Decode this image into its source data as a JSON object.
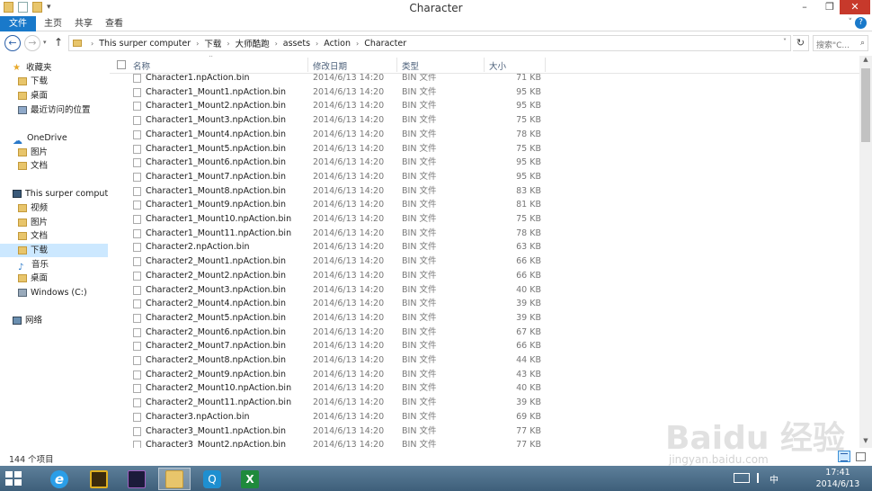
{
  "window": {
    "title": "Character",
    "minimize_glyph": "–",
    "maximize_glyph": "❐",
    "close_glyph": "✕"
  },
  "ribbon": {
    "tabs": [
      {
        "label": "文件",
        "active": true
      },
      {
        "label": "主页"
      },
      {
        "label": "共享"
      },
      {
        "label": "查看"
      }
    ],
    "expand_glyph": "˅",
    "help_glyph": "?"
  },
  "address": {
    "crumbs": [
      "This surper computer",
      "下载",
      "大师酷跑",
      "assets",
      "Action",
      "Character"
    ],
    "refresh_glyph": "↻",
    "search_placeholder": "搜索\"C...",
    "search_icon": "search-icon"
  },
  "nav": {
    "items": [
      {
        "label": "收藏夹",
        "icon": "star-icon",
        "level": 0
      },
      {
        "label": "下载",
        "icon": "folder-icon",
        "level": 1
      },
      {
        "label": "桌面",
        "icon": "folder-icon",
        "level": 1
      },
      {
        "label": "最近访问的位置",
        "icon": "recent-icon",
        "level": 1
      },
      {
        "label": "OneDrive",
        "icon": "cloud-icon",
        "level": 0
      },
      {
        "label": "图片",
        "icon": "folder-icon",
        "level": 1
      },
      {
        "label": "文档",
        "icon": "folder-icon",
        "level": 1
      },
      {
        "label": "This surper computer",
        "icon": "computer-icon",
        "level": 0
      },
      {
        "label": "视频",
        "icon": "folder-icon",
        "level": 1
      },
      {
        "label": "图片",
        "icon": "folder-icon",
        "level": 1
      },
      {
        "label": "文档",
        "icon": "folder-icon",
        "level": 1
      },
      {
        "label": "下载",
        "icon": "folder-icon",
        "level": 1,
        "selected": true
      },
      {
        "label": "音乐",
        "icon": "music-icon",
        "level": 1
      },
      {
        "label": "桌面",
        "icon": "folder-icon",
        "level": 1
      },
      {
        "label": "Windows (C:)",
        "icon": "drive-icon",
        "level": 1
      },
      {
        "label": "网络",
        "icon": "network-icon",
        "level": 0
      }
    ]
  },
  "filelist": {
    "columns": {
      "name": "名称",
      "date": "修改日期",
      "type": "类型",
      "size": "大小"
    },
    "rows": [
      {
        "name": "Character1.npAction.bin",
        "date": "2014/6/13 14:20",
        "type": "BIN 文件",
        "size": "71 KB"
      },
      {
        "name": "Character1_Mount1.npAction.bin",
        "date": "2014/6/13 14:20",
        "type": "BIN 文件",
        "size": "95 KB"
      },
      {
        "name": "Character1_Mount2.npAction.bin",
        "date": "2014/6/13 14:20",
        "type": "BIN 文件",
        "size": "95 KB"
      },
      {
        "name": "Character1_Mount3.npAction.bin",
        "date": "2014/6/13 14:20",
        "type": "BIN 文件",
        "size": "75 KB"
      },
      {
        "name": "Character1_Mount4.npAction.bin",
        "date": "2014/6/13 14:20",
        "type": "BIN 文件",
        "size": "78 KB"
      },
      {
        "name": "Character1_Mount5.npAction.bin",
        "date": "2014/6/13 14:20",
        "type": "BIN 文件",
        "size": "75 KB"
      },
      {
        "name": "Character1_Mount6.npAction.bin",
        "date": "2014/6/13 14:20",
        "type": "BIN 文件",
        "size": "95 KB"
      },
      {
        "name": "Character1_Mount7.npAction.bin",
        "date": "2014/6/13 14:20",
        "type": "BIN 文件",
        "size": "95 KB"
      },
      {
        "name": "Character1_Mount8.npAction.bin",
        "date": "2014/6/13 14:20",
        "type": "BIN 文件",
        "size": "83 KB"
      },
      {
        "name": "Character1_Mount9.npAction.bin",
        "date": "2014/6/13 14:20",
        "type": "BIN 文件",
        "size": "81 KB"
      },
      {
        "name": "Character1_Mount10.npAction.bin",
        "date": "2014/6/13 14:20",
        "type": "BIN 文件",
        "size": "75 KB"
      },
      {
        "name": "Character1_Mount11.npAction.bin",
        "date": "2014/6/13 14:20",
        "type": "BIN 文件",
        "size": "78 KB"
      },
      {
        "name": "Character2.npAction.bin",
        "date": "2014/6/13 14:20",
        "type": "BIN 文件",
        "size": "63 KB"
      },
      {
        "name": "Character2_Mount1.npAction.bin",
        "date": "2014/6/13 14:20",
        "type": "BIN 文件",
        "size": "66 KB"
      },
      {
        "name": "Character2_Mount2.npAction.bin",
        "date": "2014/6/13 14:20",
        "type": "BIN 文件",
        "size": "66 KB"
      },
      {
        "name": "Character2_Mount3.npAction.bin",
        "date": "2014/6/13 14:20",
        "type": "BIN 文件",
        "size": "40 KB"
      },
      {
        "name": "Character2_Mount4.npAction.bin",
        "date": "2014/6/13 14:20",
        "type": "BIN 文件",
        "size": "39 KB"
      },
      {
        "name": "Character2_Mount5.npAction.bin",
        "date": "2014/6/13 14:20",
        "type": "BIN 文件",
        "size": "39 KB"
      },
      {
        "name": "Character2_Mount6.npAction.bin",
        "date": "2014/6/13 14:20",
        "type": "BIN 文件",
        "size": "67 KB"
      },
      {
        "name": "Character2_Mount7.npAction.bin",
        "date": "2014/6/13 14:20",
        "type": "BIN 文件",
        "size": "66 KB"
      },
      {
        "name": "Character2_Mount8.npAction.bin",
        "date": "2014/6/13 14:20",
        "type": "BIN 文件",
        "size": "44 KB"
      },
      {
        "name": "Character2_Mount9.npAction.bin",
        "date": "2014/6/13 14:20",
        "type": "BIN 文件",
        "size": "43 KB"
      },
      {
        "name": "Character2_Mount10.npAction.bin",
        "date": "2014/6/13 14:20",
        "type": "BIN 文件",
        "size": "40 KB"
      },
      {
        "name": "Character2_Mount11.npAction.bin",
        "date": "2014/6/13 14:20",
        "type": "BIN 文件",
        "size": "39 KB"
      },
      {
        "name": "Character3.npAction.bin",
        "date": "2014/6/13 14:20",
        "type": "BIN 文件",
        "size": "69 KB"
      },
      {
        "name": "Character3_Mount1.npAction.bin",
        "date": "2014/6/13 14:20",
        "type": "BIN 文件",
        "size": "77 KB"
      },
      {
        "name": "Character3_Mount2.npAction.bin",
        "date": "2014/6/13 14:20",
        "type": "BIN 文件",
        "size": "77 KB"
      }
    ]
  },
  "status": {
    "item_count": "144 个项目"
  },
  "taskbar": {
    "apps": [
      {
        "name": "internet-explorer-icon",
        "glyph": "e"
      },
      {
        "name": "game-app-icon",
        "glyph": ""
      },
      {
        "name": "game-app-2-icon",
        "glyph": ""
      },
      {
        "name": "file-explorer-icon",
        "glyph": "",
        "active": true
      },
      {
        "name": "qq-icon",
        "glyph": "Q"
      },
      {
        "name": "excel-icon",
        "glyph": "X"
      }
    ],
    "ime": "中",
    "time": "17:41",
    "date": "2014/6/13"
  },
  "watermark": {
    "logo": "Baidu 经验",
    "url": "jingyan.baidu.com"
  },
  "colors": {
    "accent": "#1979ca",
    "close": "#c7392b",
    "selected_nav": "#cce8ff",
    "taskbar": "#4e6f8a"
  }
}
